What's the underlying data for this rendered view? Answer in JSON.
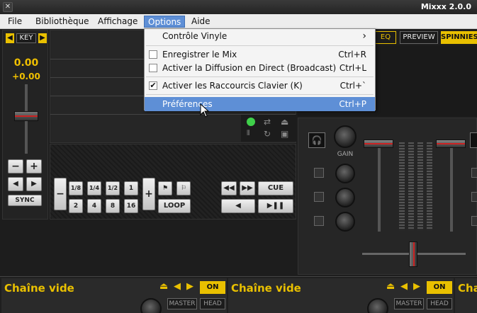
{
  "window": {
    "title": "Mixxx 2.0.0",
    "close_glyph": "✕"
  },
  "menubar": {
    "items": [
      {
        "label": "File"
      },
      {
        "label": "Bibliothèque"
      },
      {
        "label": "Affichage"
      },
      {
        "label": "Options"
      },
      {
        "label": "Aide"
      }
    ]
  },
  "options_menu": {
    "items": [
      {
        "label": "Contrôle Vinyle",
        "submenu_glyph": "›"
      },
      {
        "label": "Enregistrer le Mix",
        "shortcut": "Ctrl+R",
        "checked": false
      },
      {
        "label": "Activer la Diffusion en Direct (Broadcast)",
        "shortcut": "Ctrl+L",
        "checked": false
      },
      {
        "label": "Activer les Raccourcis Clavier (K)",
        "shortcut": "Ctrl+`",
        "checked": true
      },
      {
        "label": "Préférences",
        "shortcut": "Ctrl+P"
      }
    ]
  },
  "deck_left": {
    "key_label": "KEY",
    "pitch_value": "0.00",
    "pitch_delta": "+0.00",
    "sync_label": "SYNC",
    "loop_sizes_top": [
      "1/8",
      "1/4",
      "1/2",
      "1"
    ],
    "loop_sizes_bottom": [
      "2",
      "4",
      "8",
      "16"
    ],
    "loop_label": "LOOP",
    "cue_label": "CUE",
    "minus_glyph": "−",
    "plus_glyph": "+"
  },
  "top_right_buttons": {
    "eq": "EQ",
    "preview": "PREVIEW",
    "spinnies": "SPINNIES"
  },
  "mixer": {
    "gain_label": "GAIN"
  },
  "effects": [
    {
      "title": "Chaîne vide",
      "on_label": "ON",
      "master": "MASTER",
      "head": "HEAD"
    },
    {
      "title": "Chaîne vide",
      "on_label": "ON",
      "master": "MASTER",
      "head": "HEAD"
    },
    {
      "title": "Cha"
    }
  ],
  "colors": {
    "accent_yellow": "#e9c000",
    "menu_highlight": "#5e8fd6",
    "pitch_text": "#f0c000"
  }
}
